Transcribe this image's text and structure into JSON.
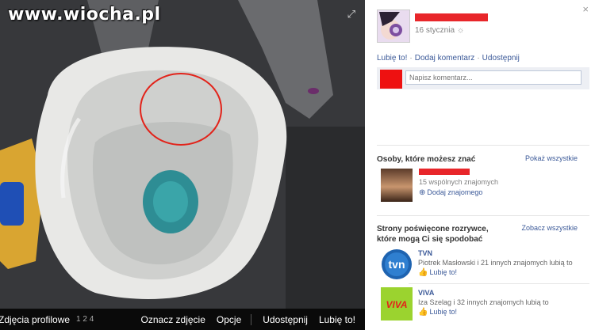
{
  "viewer": {
    "watermark": "www.wiocha.pl",
    "caption": "Zdjęcia profilowe",
    "pages": "1 2 4",
    "actions": [
      "Oznacz zdjęcie",
      "Opcje",
      "Udostępnij",
      "Lubię to!"
    ],
    "expand_glyph": "⤢"
  },
  "side": {
    "close_glyph": "×",
    "date": "16 stycznia",
    "globe_glyph": "☼",
    "post_links": [
      "Lubię to!",
      "Dodaj komentarz",
      "Udostępnij"
    ],
    "comment_placeholder": "Napisz komentarz...",
    "people": {
      "heading": "Osoby, które możesz znać",
      "see_all": "Pokaż wszystkie",
      "mutual": "15 wspólnych znajomych",
      "add": "Dodaj znajomego"
    },
    "pages": {
      "heading": "Strony poświęcone rozrywce, które mogą Ci się spodobać",
      "see_all": "Zobacz wszystkie",
      "items": [
        {
          "name": "TVN",
          "sub": "Piotrek Masłowski i 21 innych znajomych lubią to",
          "like": "Lubię to!",
          "logo": "tvn"
        },
        {
          "name": "VIVA",
          "sub": "Iza Szelag i 32 innych znajomych lubią to",
          "like": "Lubię to!",
          "logo": "VIVA"
        }
      ]
    }
  },
  "colors": {
    "fb_link": "#3b5998",
    "redact": "#e8262a",
    "tvn_blue": "#1e63b0",
    "viva_green": "#9bd32f"
  }
}
